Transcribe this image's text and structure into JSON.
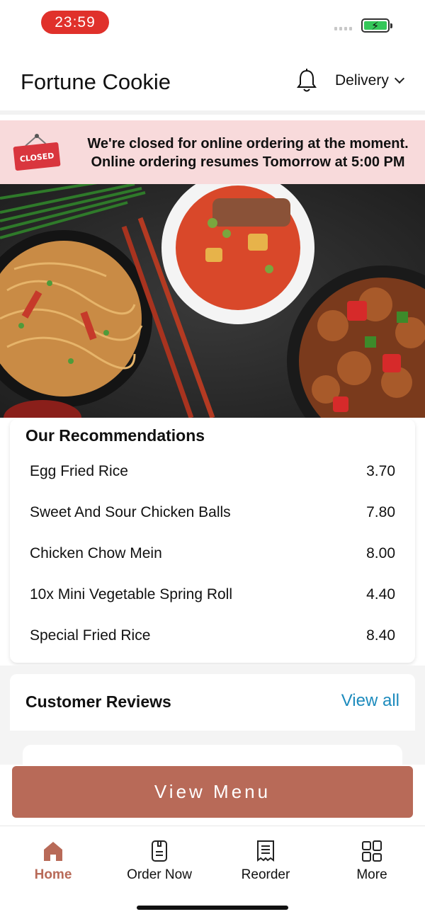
{
  "status_bar": {
    "time": "23:59"
  },
  "header": {
    "title": "Fortune Cookie",
    "delivery_label": "Delivery"
  },
  "closed_banner": {
    "sign_text": "CLOSED",
    "line1": "We're closed for online ordering at the moment.",
    "line2": "Online ordering resumes Tomorrow at 5:00 PM"
  },
  "recommendations": {
    "title": "Our Recommendations",
    "items": [
      {
        "name": "Egg Fried Rice",
        "price": "3.70"
      },
      {
        "name": "Sweet And Sour Chicken Balls",
        "price": "7.80"
      },
      {
        "name": "Chicken Chow Mein",
        "price": "8.00"
      },
      {
        "name": "10x Mini Vegetable Spring Roll",
        "price": "4.40"
      },
      {
        "name": "Special Fried Rice",
        "price": "8.40"
      }
    ]
  },
  "reviews": {
    "title": "Customer Reviews",
    "view_all": "View all"
  },
  "cta": {
    "label": "View Menu"
  },
  "nav": {
    "items": [
      {
        "label": "Home",
        "icon": "home-icon"
      },
      {
        "label": "Order Now",
        "icon": "order-icon"
      },
      {
        "label": "Reorder",
        "icon": "receipt-icon"
      },
      {
        "label": "More",
        "icon": "grid-icon"
      }
    ]
  },
  "colors": {
    "accent": "#b86a58",
    "link": "#1d8bbd",
    "banner_bg": "#f8dadb",
    "time_pill": "#e0312b"
  }
}
